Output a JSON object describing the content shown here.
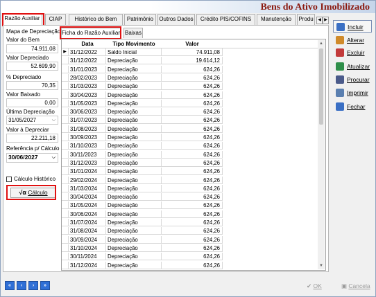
{
  "title": "Bens do Ativo Imobilizado",
  "main_tabs": [
    "Razão Auxiliar",
    "CIAP",
    "Histórico do Bem",
    "Patrimônio",
    "Outros Dados",
    "Crédito PIS/COFINS",
    "Manutenção",
    "Produ"
  ],
  "sub_tabs": [
    "Ficha do Razão Auxiliar",
    "Baixas"
  ],
  "left_panel": {
    "mapa_label": "Mapa de Depreciação",
    "valor_bem_label": "Valor do Bem",
    "valor_bem": "74.911,08",
    "valor_depreciado_label": "Valor Depreciado",
    "valor_depreciado": "52.699,90",
    "pct_depreciado_label": "% Depreciado",
    "pct_depreciado": "70,35",
    "valor_baixado_label": "Valor Baixado",
    "valor_baixado": "0,00",
    "ultima_depreciacao_label": "Última Depreciação",
    "ultima_depreciacao": "31/05/2027",
    "valor_a_depreciar_label": "Valor à Depreciar",
    "valor_a_depreciar": "22.211,18",
    "referencia_label": "Referência p/ Cálculo",
    "referencia": "30/06/2027",
    "calculo_historico_label": "Cálculo Histórico",
    "calculo_button": "Cálculo",
    "calculo_symbol": "√α"
  },
  "grid": {
    "columns": [
      "Data",
      "Tipo Movimento",
      "Valor"
    ],
    "rows": [
      [
        "31/12/2022",
        "Saldo Inicial",
        "74.911,08"
      ],
      [
        "31/12/2022",
        "Depreciação",
        "19.614,12"
      ],
      [
        "31/01/2023",
        "Depreciação",
        "624,26"
      ],
      [
        "28/02/2023",
        "Depreciação",
        "624,26"
      ],
      [
        "31/03/2023",
        "Depreciação",
        "624,26"
      ],
      [
        "30/04/2023",
        "Depreciação",
        "624,26"
      ],
      [
        "31/05/2023",
        "Depreciação",
        "624,26"
      ],
      [
        "30/06/2023",
        "Depreciação",
        "624,26"
      ],
      [
        "31/07/2023",
        "Depreciação",
        "624,26"
      ],
      [
        "31/08/2023",
        "Depreciação",
        "624,26"
      ],
      [
        "30/09/2023",
        "Depreciação",
        "624,26"
      ],
      [
        "31/10/2023",
        "Depreciação",
        "624,26"
      ],
      [
        "30/11/2023",
        "Depreciação",
        "624,26"
      ],
      [
        "31/12/2023",
        "Depreciação",
        "624,26"
      ],
      [
        "31/01/2024",
        "Depreciação",
        "624,26"
      ],
      [
        "29/02/2024",
        "Depreciação",
        "624,26"
      ],
      [
        "31/03/2024",
        "Depreciação",
        "624,26"
      ],
      [
        "30/04/2024",
        "Depreciação",
        "624,26"
      ],
      [
        "31/05/2024",
        "Depreciação",
        "624,26"
      ],
      [
        "30/06/2024",
        "Depreciação",
        "624,26"
      ],
      [
        "31/07/2024",
        "Depreciação",
        "624,26"
      ],
      [
        "31/08/2024",
        "Depreciação",
        "624,26"
      ],
      [
        "30/09/2024",
        "Depreciação",
        "624,26"
      ],
      [
        "31/10/2024",
        "Depreciação",
        "624,26"
      ],
      [
        "30/11/2024",
        "Depreciação",
        "624,26"
      ],
      [
        "31/12/2024",
        "Depreciação",
        "624,26"
      ]
    ],
    "current_row_marker": "▶"
  },
  "side_buttons": [
    {
      "label": "Incluir",
      "icon": "new-document-icon"
    },
    {
      "label": "Alterar",
      "icon": "edit-pencil-icon"
    },
    {
      "label": "Excluir",
      "icon": "delete-icon"
    },
    {
      "label": "Atualizar",
      "icon": "refresh-icon"
    },
    {
      "label": "Procurar",
      "icon": "binoculars-icon"
    },
    {
      "label": "Imprimir",
      "icon": "printer-icon"
    },
    {
      "label": "Fechar",
      "icon": "close-door-icon"
    }
  ],
  "nav_buttons": [
    {
      "glyph": "«",
      "icon": "first-record-icon"
    },
    {
      "glyph": "‹",
      "icon": "prior-record-icon"
    },
    {
      "glyph": "›",
      "icon": "next-record-icon"
    },
    {
      "glyph": "»",
      "icon": "last-record-icon"
    }
  ],
  "footer": {
    "ok_label": "OK",
    "cancel_label": "Cancela"
  },
  "colors": {
    "title": "#8b1a10",
    "highlight": "#e01010",
    "nav": "#2f6fd6"
  }
}
